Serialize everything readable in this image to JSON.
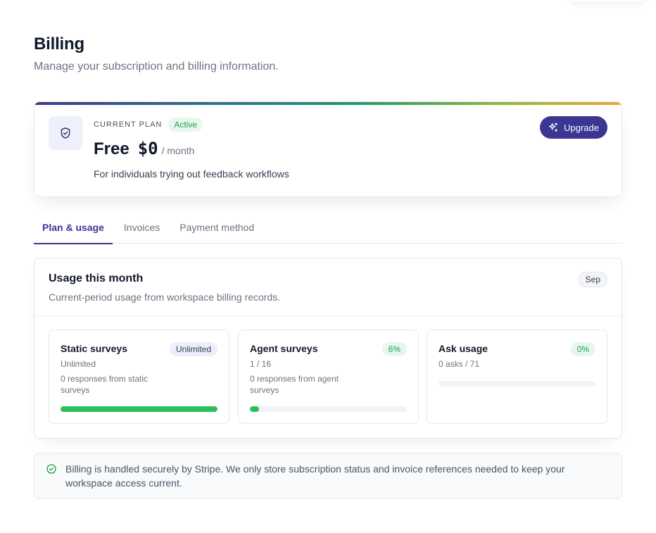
{
  "header": {
    "title": "Billing",
    "subtitle": "Manage your subscription and billing information."
  },
  "plan": {
    "eyebrow": "CURRENT PLAN",
    "status": "Active",
    "name": "Free",
    "price": "$0",
    "period": "/ month",
    "description": "For individuals trying out feedback workflows",
    "upgrade_label": "Upgrade",
    "icon": "shield-check-icon"
  },
  "tabs": [
    {
      "label": "Plan & usage",
      "active": true
    },
    {
      "label": "Invoices",
      "active": false
    },
    {
      "label": "Payment method",
      "active": false
    }
  ],
  "usage": {
    "title": "Usage this month",
    "subtitle": "Current-period usage from workspace billing records.",
    "month": "Sep",
    "metrics": [
      {
        "title": "Static surveys",
        "badge": "Unlimited",
        "sub": "Unlimited",
        "note": "0 responses from static surveys",
        "progress": 1.0
      },
      {
        "title": "Agent surveys",
        "badge": "6%",
        "sub": "1 / 16",
        "note": "0 responses from agent surveys",
        "progress": 0.06
      },
      {
        "title": "Ask usage",
        "badge": "0%",
        "sub": "0 asks / 71",
        "note": "",
        "progress": 0
      }
    ]
  },
  "banner": {
    "text": "Billing is handled securely by Stripe. We only store subscription status and invoice references needed to keep your workspace access current.",
    "icon": "check-circle-icon"
  },
  "colors": {
    "accent": "#3b3593",
    "success": "#16a34a",
    "progress": "#2ebd5b"
  }
}
